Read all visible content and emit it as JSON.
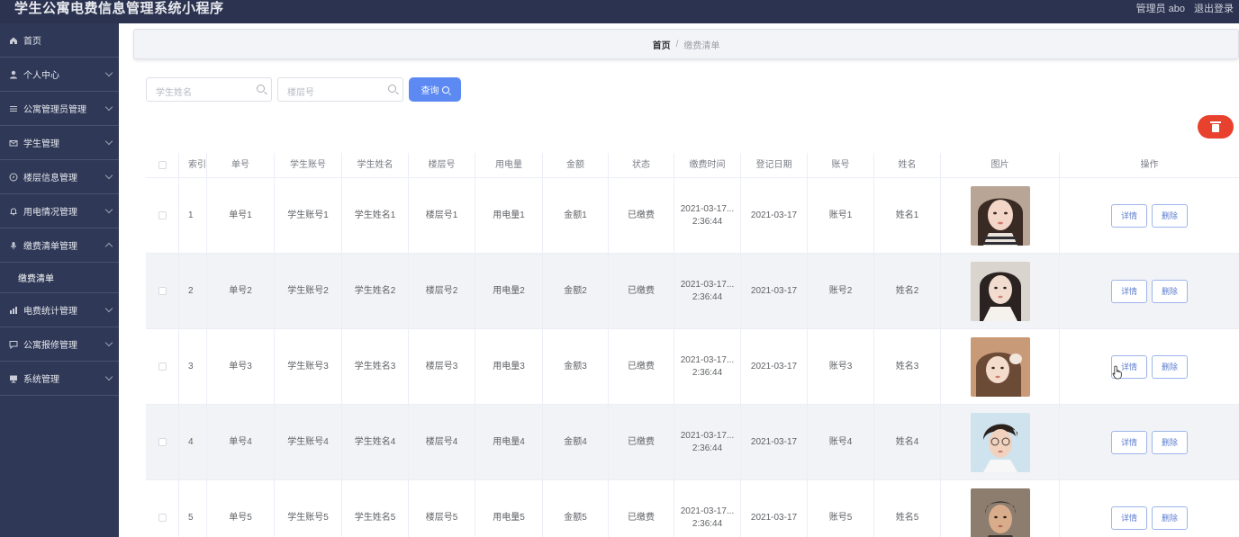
{
  "app": {
    "title": "学生公寓电费信息管理系统小程序",
    "user_label": "管理员 abo",
    "logout_label": "退出登录"
  },
  "sidebar": {
    "items": [
      {
        "label": "首页",
        "icon": "home-icon"
      },
      {
        "label": "个人中心",
        "icon": "person-icon"
      },
      {
        "label": "公寓管理员管理",
        "icon": "list-icon"
      },
      {
        "label": "学生管理",
        "icon": "mail-icon"
      },
      {
        "label": "楼层信息管理",
        "icon": "compass-icon"
      },
      {
        "label": "用电情况管理",
        "icon": "bell-icon"
      },
      {
        "label": "缴费清单管理",
        "icon": "mic-icon",
        "expanded": true,
        "children": [
          {
            "label": "缴费清单"
          }
        ]
      },
      {
        "label": "电费统计管理",
        "icon": "chart-icon"
      },
      {
        "label": "公寓报修管理",
        "icon": "chat-icon"
      },
      {
        "label": "系统管理",
        "icon": "monitor-icon"
      }
    ]
  },
  "breadcrumb": {
    "home": "首页",
    "separator": "/",
    "current": "缴费清单"
  },
  "search": {
    "student_name_placeholder": "学生姓名",
    "floor_placeholder": "楼层号",
    "query_label": "查询"
  },
  "table": {
    "columns": [
      "索引",
      "单号",
      "学生账号",
      "学生姓名",
      "楼层号",
      "用电量",
      "金额",
      "状态",
      "缴费时间",
      "登记日期",
      "账号",
      "姓名",
      "图片",
      "操作"
    ],
    "detail_label": "详情",
    "delete_label": "删除",
    "rows": [
      {
        "index": "1",
        "order": "单号1",
        "account": "学生账号1",
        "name": "学生姓名1",
        "floor": "楼层号1",
        "usage": "用电量1",
        "amount": "金额1",
        "status": "已缴费",
        "pay_date": "2021-03-17...",
        "pay_time": "2:36:44",
        "reg_date": "2021-03-17",
        "acct": "账号1",
        "realname": "姓名1"
      },
      {
        "index": "2",
        "order": "单号2",
        "account": "学生账号2",
        "name": "学生姓名2",
        "floor": "楼层号2",
        "usage": "用电量2",
        "amount": "金额2",
        "status": "已缴费",
        "pay_date": "2021-03-17...",
        "pay_time": "2:36:44",
        "reg_date": "2021-03-17",
        "acct": "账号2",
        "realname": "姓名2"
      },
      {
        "index": "3",
        "order": "单号3",
        "account": "学生账号3",
        "name": "学生姓名3",
        "floor": "楼层号3",
        "usage": "用电量3",
        "amount": "金额3",
        "status": "已缴费",
        "pay_date": "2021-03-17...",
        "pay_time": "2:36:44",
        "reg_date": "2021-03-17",
        "acct": "账号3",
        "realname": "姓名3"
      },
      {
        "index": "4",
        "order": "单号4",
        "account": "学生账号4",
        "name": "学生姓名4",
        "floor": "楼层号4",
        "usage": "用电量4",
        "amount": "金额4",
        "status": "已缴费",
        "pay_date": "2021-03-17...",
        "pay_time": "2:36:44",
        "reg_date": "2021-03-17",
        "acct": "账号4",
        "realname": "姓名4"
      },
      {
        "index": "5",
        "order": "单号5",
        "account": "学生账号5",
        "name": "学生姓名5",
        "floor": "楼层号5",
        "usage": "用电量5",
        "amount": "金额5",
        "status": "已缴费",
        "pay_date": "2021-03-17...",
        "pay_time": "2:36:44",
        "reg_date": "2021-03-17",
        "acct": "账号5",
        "realname": "姓名5"
      }
    ]
  },
  "colors": {
    "sidebar_bg": "#2f3856",
    "topbar_bg": "#2b3350",
    "primary": "#5d8af2",
    "danger": "#e8412e"
  }
}
